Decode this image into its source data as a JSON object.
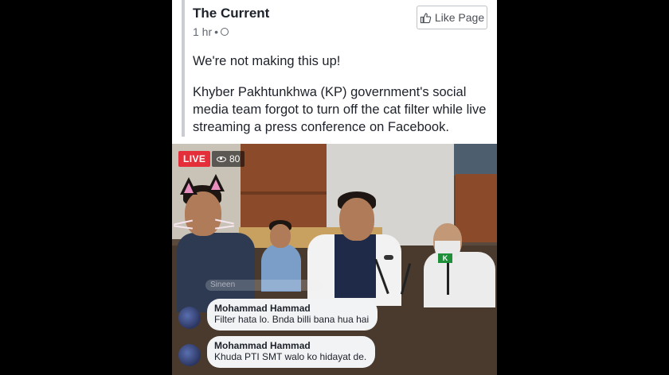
{
  "post": {
    "page_name": "The Current",
    "time": "1 hr",
    "separator": "•",
    "privacy_icon": "globe-icon",
    "like_button": {
      "icon": "thumbs-up-icon",
      "label": "Like Page"
    },
    "text_line1": "We're not making this up!",
    "text_line2": "Khyber Pakhtunkhwa (KP) government's social media team forgot to turn off the cat filter while live streaming a press conference on Facebook."
  },
  "video": {
    "live_label": "LIVE",
    "viewer_icon": "eye-icon",
    "viewer_count": "80",
    "mic_label": "K",
    "faded_comment": "Sineen",
    "comments": [
      {
        "author": "Mohammad Hammad",
        "text": "Filter hata lo. Bnda billi bana hua hai"
      },
      {
        "author": "Mohammad Hammad",
        "text": "Khuda PTI SMT walo ko hidayat de."
      }
    ]
  },
  "colors": {
    "live_red": "#e42f3a",
    "text_dark": "#1d2129",
    "meta_gray": "#606770",
    "cat_ear_pink": "#e88fc0"
  }
}
